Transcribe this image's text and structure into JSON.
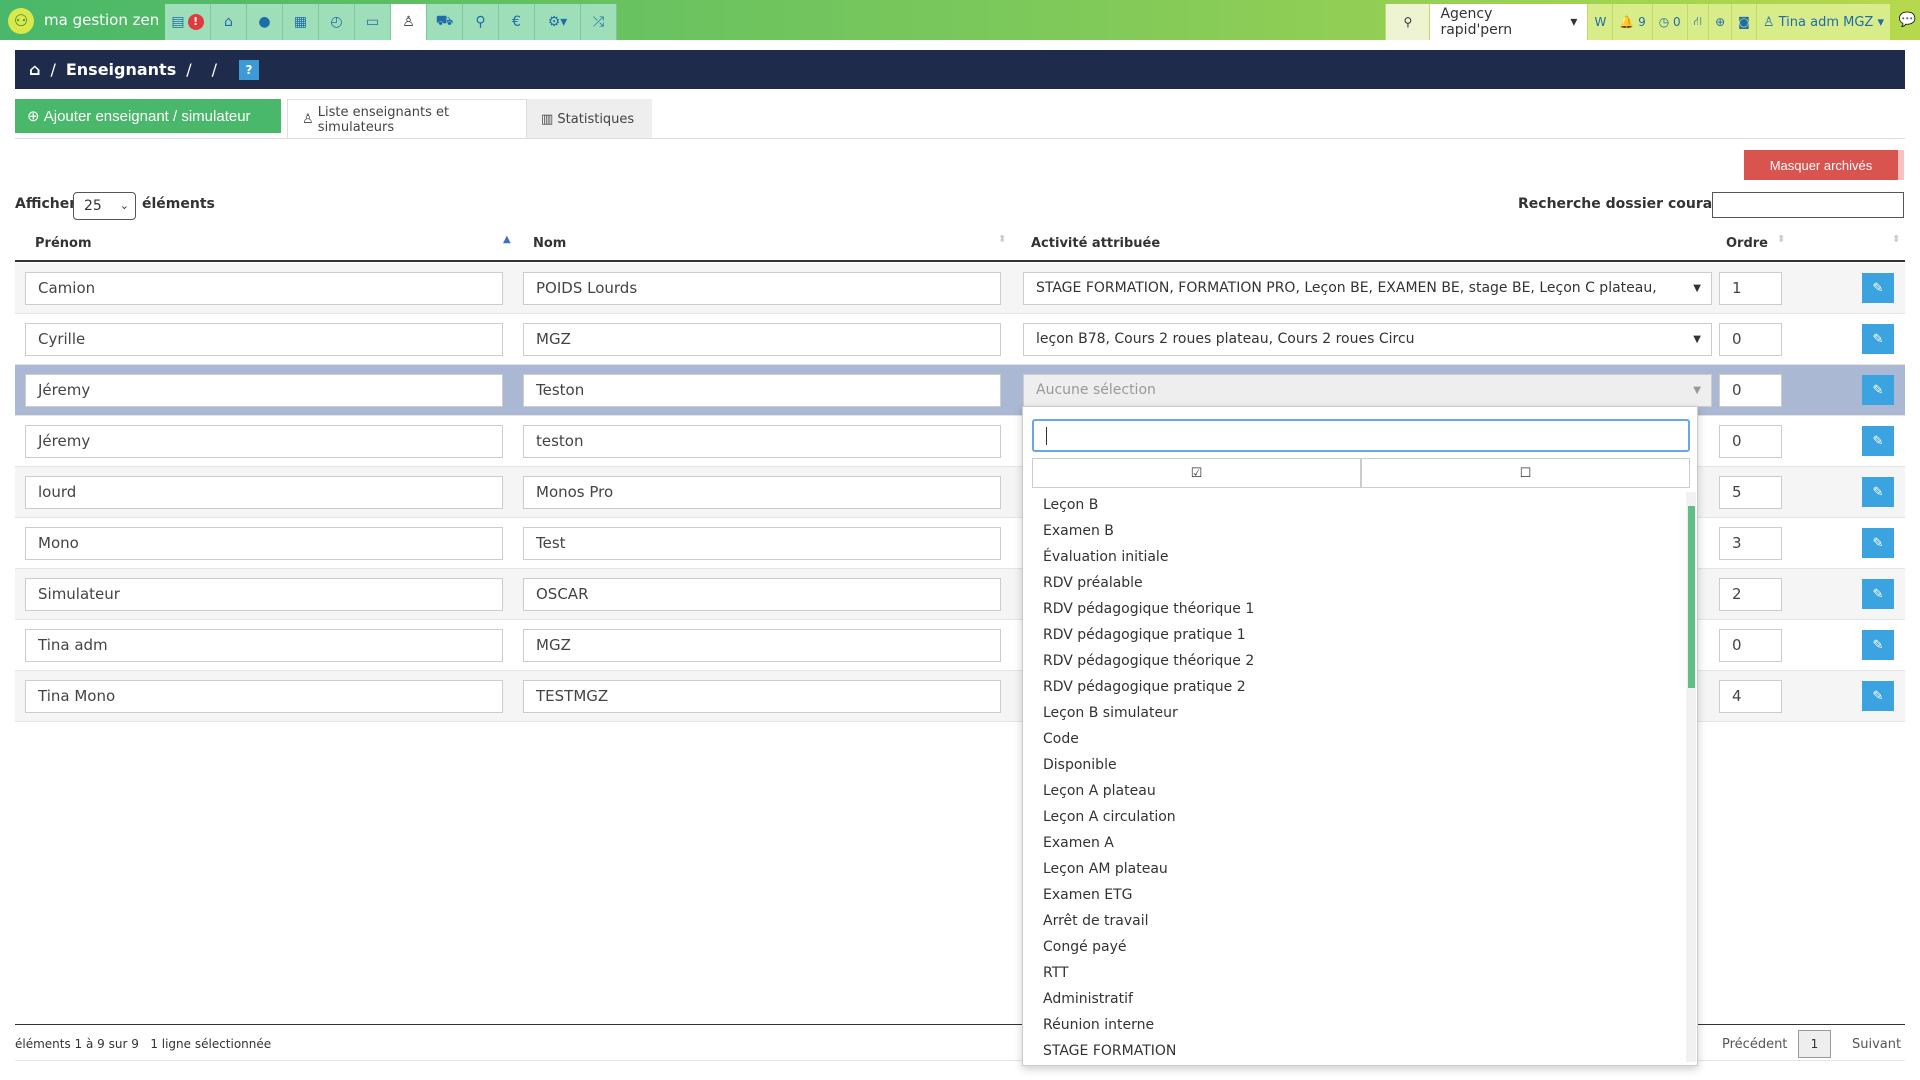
{
  "app": {
    "brand": "ma gestion zen",
    "alert_count": "!"
  },
  "topnav": {
    "agency": "Agency rapid'pern",
    "w_label": "W",
    "notif_count": "9",
    "timer_count": "0",
    "user": "Tina adm MGZ"
  },
  "breadcrumb": {
    "title": "Enseignants",
    "sep1": "/",
    "sep2": "/",
    "help": "?"
  },
  "toolbar": {
    "add_label": "Ajouter enseignant / simulateur",
    "tab_list": "Liste enseignants et simulateurs",
    "tab_stats": "Statistiques",
    "archive_label": "Masquer archivés"
  },
  "controls": {
    "show_label": "Afficher",
    "show_value": "25",
    "show_suffix": "éléments",
    "search_label": "Recherche dossier courant :",
    "search_value": ""
  },
  "table": {
    "headers": {
      "first": "Prénom",
      "last": "Nom",
      "activity": "Activité attribuée",
      "order": "Ordre"
    },
    "rows": [
      {
        "first": "Camion",
        "last": "POIDS Lourds",
        "activity": "STAGE FORMATION, FORMATION PRO, Leçon BE, EXAMEN BE, stage BE, Leçon C plateau,",
        "order": "1"
      },
      {
        "first": "Cyrille",
        "last": "MGZ",
        "activity": "leçon B78, Cours 2 roues plateau, Cours 2 roues Circu",
        "order": "0"
      },
      {
        "first": "Jéremy",
        "last": "Teston",
        "activity": "Aucune sélection",
        "order": "0"
      },
      {
        "first": "Jéremy",
        "last": "teston",
        "activity": "",
        "order": "0"
      },
      {
        "first": "lourd",
        "last": "Monos Pro",
        "activity": "",
        "order": "5"
      },
      {
        "first": "Mono",
        "last": "Test",
        "activity": "",
        "order": "3"
      },
      {
        "first": "Simulateur",
        "last": "OSCAR",
        "activity": "",
        "order": "2"
      },
      {
        "first": "Tina adm",
        "last": "MGZ",
        "activity": "",
        "order": "0"
      },
      {
        "first": "Tina Mono",
        "last": "TESTMGZ",
        "activity": "",
        "order": "4"
      }
    ]
  },
  "dropdown": {
    "search_value": "",
    "options": [
      "Leçon B",
      "Examen B",
      "Évaluation initiale",
      "RDV préalable",
      "RDV pédagogique théorique 1",
      "RDV pédagogique pratique 1",
      "RDV pédagogique théorique 2",
      "RDV pédagogique pratique 2",
      "Leçon B simulateur",
      "Code",
      "Disponible",
      "Leçon A plateau",
      "Leçon A circulation",
      "Examen A",
      "Leçon AM plateau",
      "Examen ETG",
      "Arrêt de travail",
      "Congé payé",
      "RTT",
      "Administratif",
      "Réunion interne",
      "STAGE FORMATION"
    ]
  },
  "footer": {
    "info": "éléments 1 à 9 sur 9",
    "selected": "1 ligne sélectionnée",
    "prev": "Précédent",
    "page": "1",
    "next": "Suivant"
  }
}
